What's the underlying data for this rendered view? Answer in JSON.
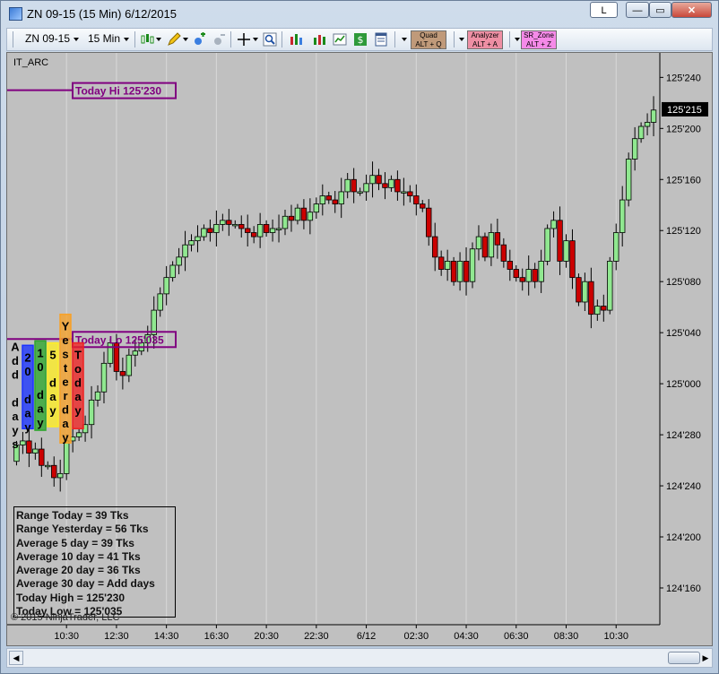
{
  "window": {
    "title": "ZN 09-15 (15 Min)  6/12/2015",
    "l_button": "L",
    "min_glyph": "—",
    "max_glyph": "▭",
    "close_glyph": "✕"
  },
  "toolbar": {
    "instrument": "ZN 09-15",
    "interval": "15 Min",
    "shortcuts": [
      {
        "label": "Quad",
        "keys": "ALT + Q",
        "color": "#c09a7a"
      },
      {
        "label": "Analyzer",
        "keys": "ALT + A",
        "color": "#ee8fa4"
      },
      {
        "label": "SR_Zone",
        "keys": "ALT + Z",
        "color": "#f58ae8"
      }
    ]
  },
  "chart": {
    "indicator_label": "IT_ARC",
    "copyright": "© 2015 NinjaTrader, LLC",
    "current_price": "125'215",
    "today_hi_label": "Today Hi 125'230",
    "today_lo_label": "Today Lo 125'035",
    "stats": [
      "Range Today = 39 Tks",
      "Range Yesterday = 56 Tks",
      "Average 5 day = 39 Tks",
      "Average 10 day = 41 Tks",
      "Average 20 day = 36 Tks",
      "Average 30 day = Add days",
      "Today High = 125'230",
      "Today Low = 125'035"
    ],
    "bars": [
      {
        "label": "Add days",
        "color": "#c0c0c0",
        "top": 125.12,
        "bottom": 124.86
      },
      {
        "label": "20 day",
        "color": "#1a33ff",
        "top": 125.094,
        "bottom": 124.89
      },
      {
        "label": "10 day",
        "color": "#2ea62e",
        "top": 125.105,
        "bottom": 124.886
      },
      {
        "label": "5 day",
        "color": "#ffee22",
        "top": 125.1,
        "bottom": 124.895
      },
      {
        "label": "Yesterday",
        "color": "#f7a128",
        "top": 125.17,
        "bottom": 124.855
      },
      {
        "label": "Today",
        "color": "#ee2222",
        "top": 125.1,
        "bottom": 124.89
      }
    ]
  },
  "chart_data": {
    "type": "candlestick",
    "y_tick_labels": [
      "125'240",
      "125'200",
      "125'160",
      "125'120",
      "125'080",
      "125'040",
      "125'000",
      "124'280",
      "124'240",
      "124'200",
      "124'160"
    ],
    "y_tick_values": [
      125.75,
      125.625,
      125.5,
      125.375,
      125.25,
      125.125,
      125.0,
      124.875,
      124.75,
      124.625,
      124.5
    ],
    "ylim": [
      124.41,
      125.81
    ],
    "x_tick_labels": [
      "10:30",
      "12:30",
      "14:30",
      "16:30",
      "20:30",
      "22:30",
      "6/12",
      "02:30",
      "04:30",
      "06:30",
      "08:30",
      "10:30"
    ],
    "x_tick_index": [
      8,
      16,
      24,
      32,
      40,
      48,
      56,
      64,
      72,
      80,
      88,
      96
    ],
    "x_range": [
      -1.5,
      103
    ],
    "today_high": 125.71875,
    "today_low": 125.109375,
    "current_price": 125.671875,
    "closes": [
      124.85,
      124.86,
      124.83,
      124.84,
      124.8,
      124.8,
      124.77,
      124.78,
      124.86,
      124.87,
      124.88,
      124.9,
      124.96,
      124.98,
      125.05,
      125.1,
      125.03,
      125.02,
      125.07,
      125.08,
      125.1,
      125.12,
      125.18,
      125.22,
      125.26,
      125.29,
      125.31,
      125.34,
      125.35,
      125.36,
      125.38,
      125.37,
      125.39,
      125.4,
      125.39,
      125.39,
      125.38,
      125.37,
      125.36,
      125.39,
      125.37,
      125.38,
      125.38,
      125.41,
      125.4,
      125.43,
      125.4,
      125.42,
      125.44,
      125.46,
      125.45,
      125.44,
      125.47,
      125.5,
      125.47,
      125.47,
      125.49,
      125.51,
      125.49,
      125.48,
      125.5,
      125.47,
      125.47,
      125.46,
      125.44,
      125.43,
      125.36,
      125.31,
      125.28,
      125.3,
      125.25,
      125.3,
      125.25,
      125.33,
      125.36,
      125.31,
      125.37,
      125.34,
      125.3,
      125.28,
      125.26,
      125.25,
      125.28,
      125.25,
      125.3,
      125.38,
      125.4,
      125.3,
      125.35,
      125.26,
      125.2,
      125.25,
      125.17,
      125.19,
      125.18,
      125.3,
      125.37,
      125.45,
      125.55,
      125.6,
      125.63,
      125.64,
      125.67
    ]
  }
}
